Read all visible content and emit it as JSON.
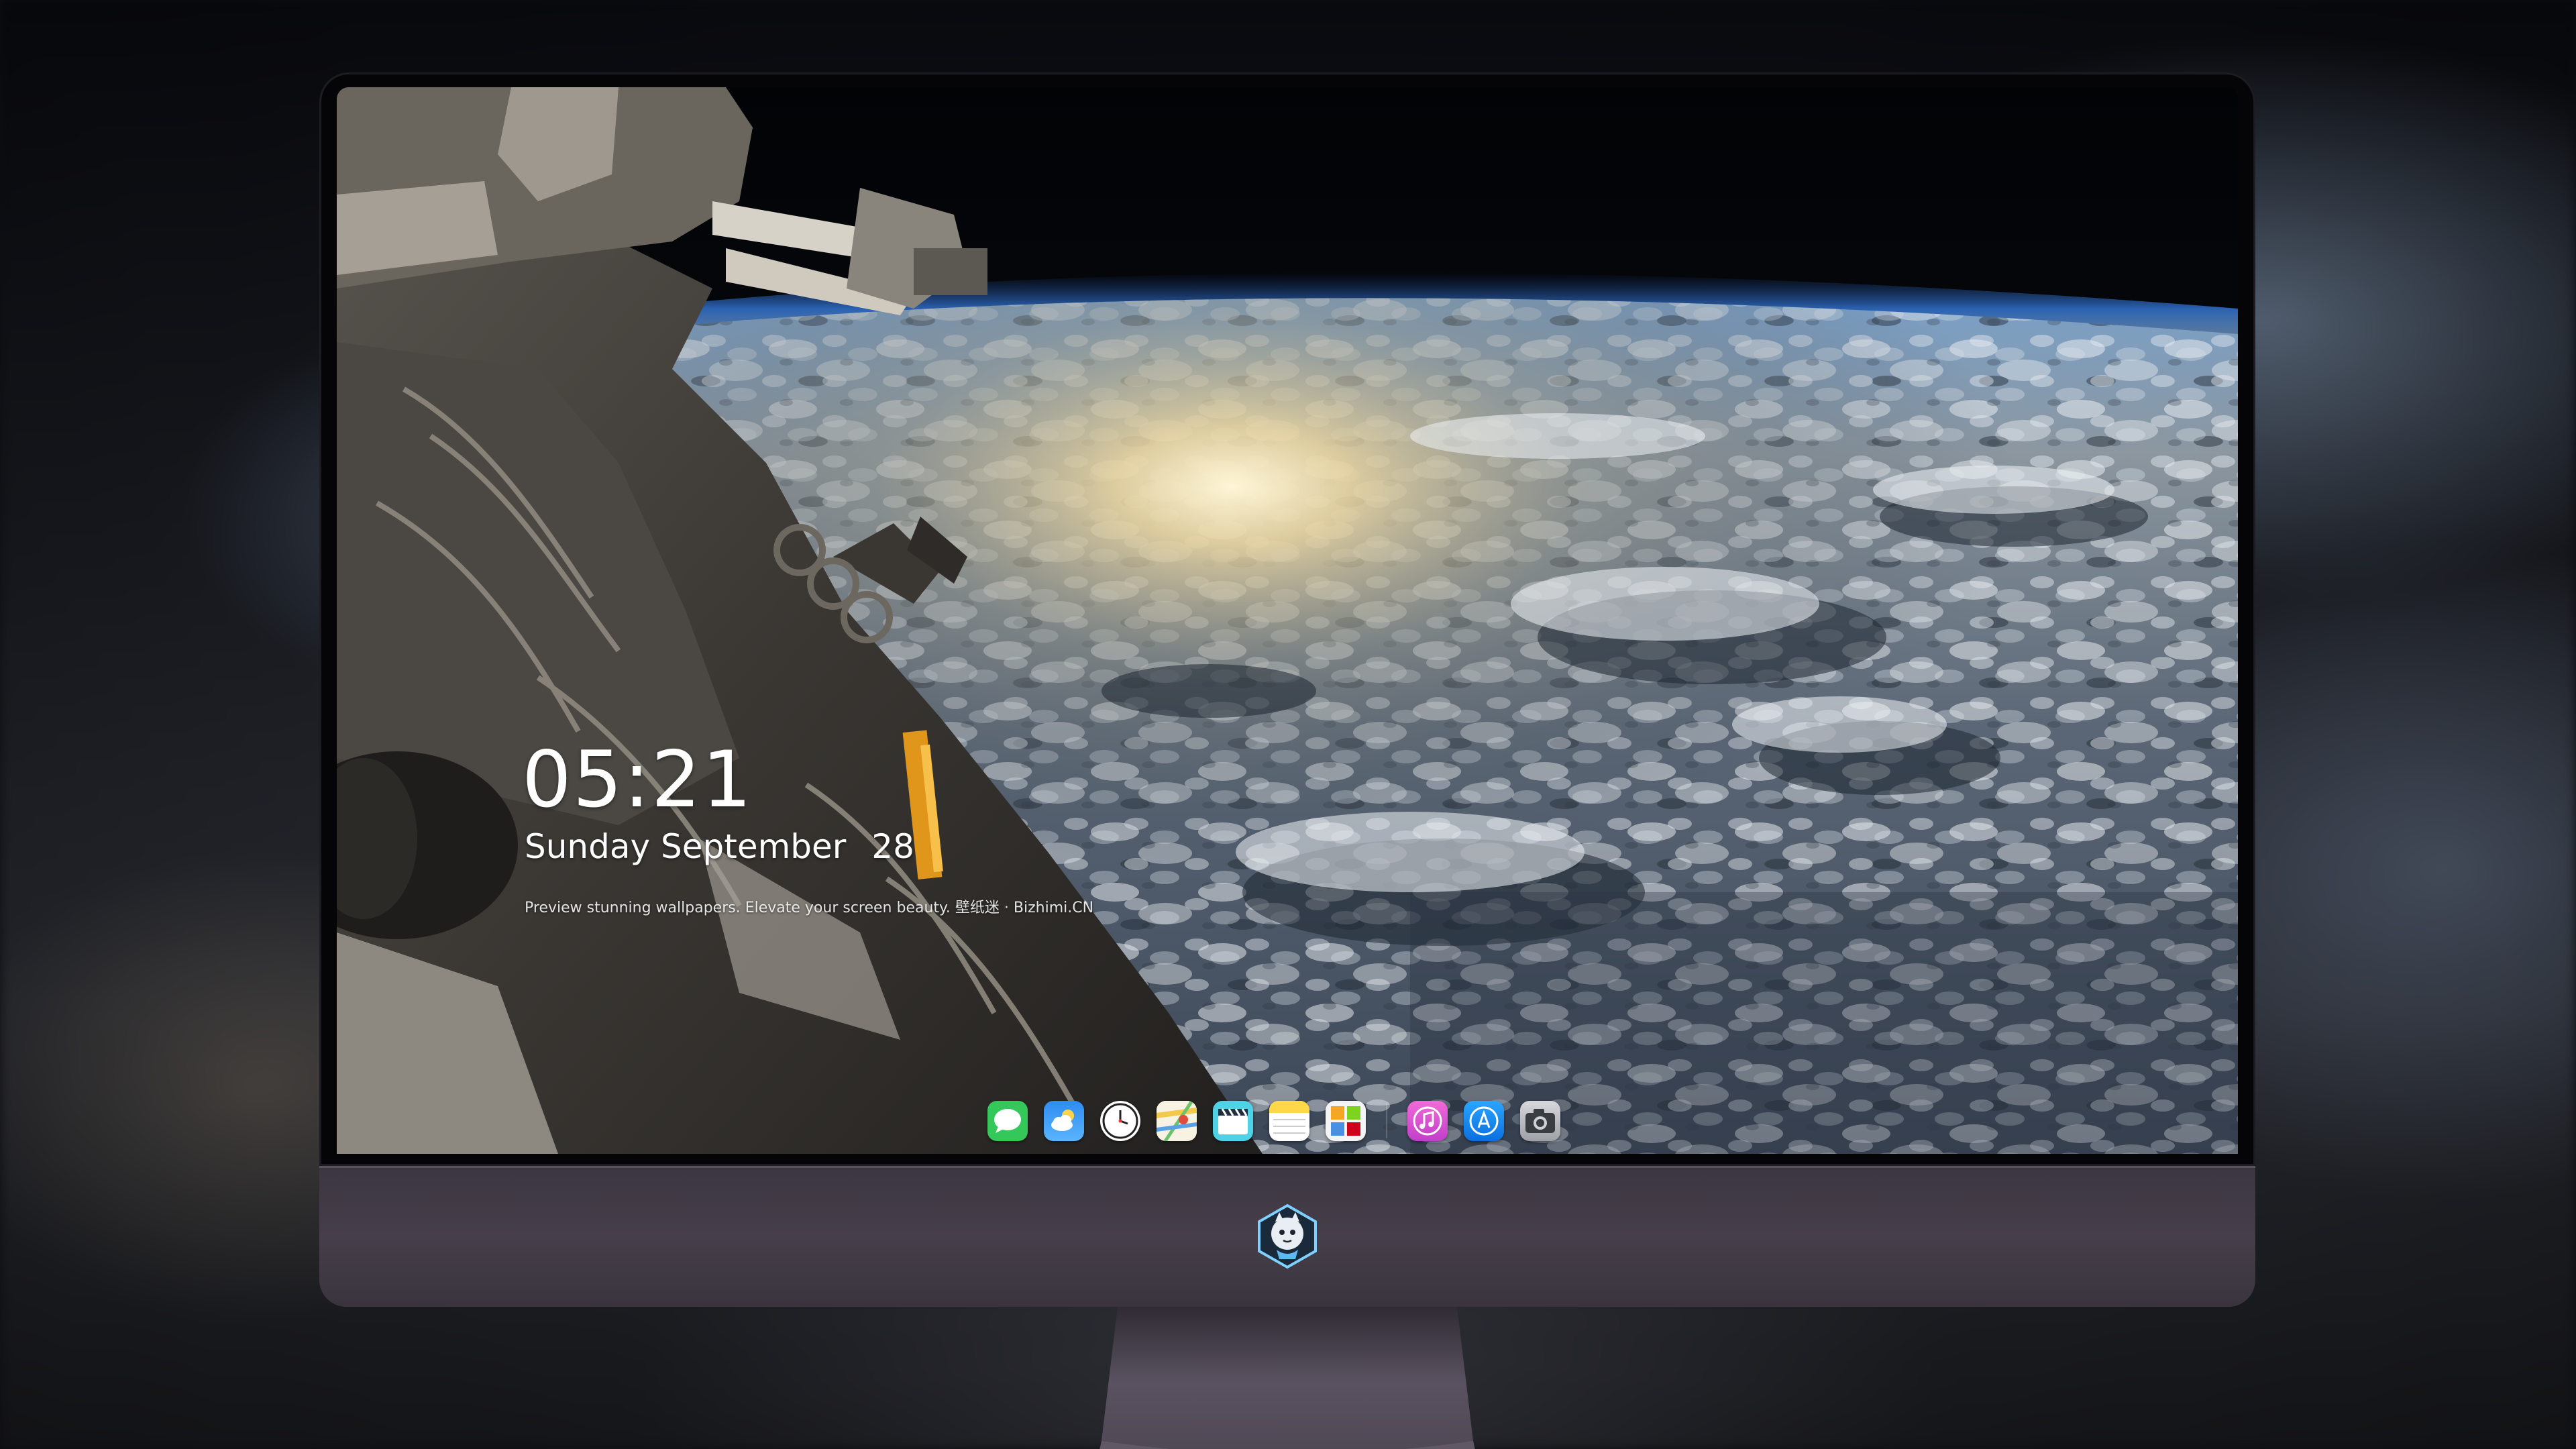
{
  "lockscreen": {
    "time": "05:21",
    "weekday": "Sunday",
    "month": "September",
    "day": "28",
    "tagline": "Preview stunning wallpapers. Elevate your screen beauty. 壁纸迷 · Bizhimi.CN"
  },
  "dock": {
    "apps": [
      {
        "name": "messages",
        "icon": "messages-icon",
        "color": "#34c759"
      },
      {
        "name": "weather",
        "icon": "weather-icon",
        "color": "#2f8cf0"
      },
      {
        "name": "clock",
        "icon": "clock-icon",
        "color": "#ffffff"
      },
      {
        "name": "maps",
        "icon": "maps-icon",
        "color": "#f3c94a"
      },
      {
        "name": "videos",
        "icon": "clapperboard-icon",
        "color": "#4fd1e6"
      },
      {
        "name": "notes",
        "icon": "notes-icon",
        "color": "#ffd84a"
      },
      {
        "name": "photos",
        "icon": "photos-icon",
        "color": "#f4f4f4"
      },
      {
        "name": "music",
        "icon": "music-icon",
        "color": "#e85cd4"
      },
      {
        "name": "app-store",
        "icon": "app-store-icon",
        "color": "#1d8cf8"
      },
      {
        "name": "camera",
        "icon": "camera-icon",
        "color": "#b9bcc2"
      }
    ]
  },
  "monitor": {
    "chin_color": "#433c47",
    "logo": "mascot-logo-icon"
  }
}
